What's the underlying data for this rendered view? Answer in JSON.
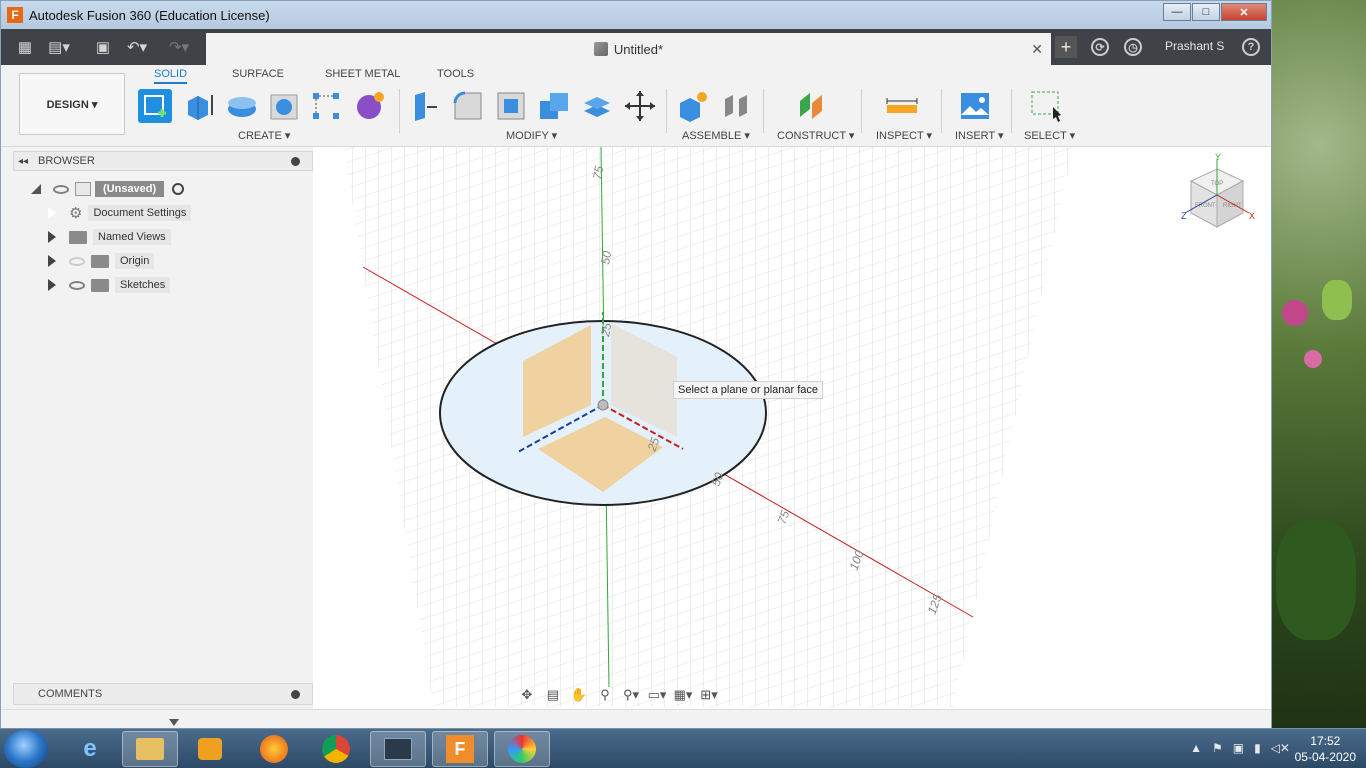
{
  "window": {
    "title": "Autodesk Fusion 360 (Education License)",
    "app_letter": "F"
  },
  "tabbar": {
    "doc_title": "Untitled*",
    "user": "Prashant S",
    "help": "?"
  },
  "toolbar": {
    "design_label": "DESIGN ▾",
    "workspace_tabs": [
      "SOLID",
      "SURFACE",
      "SHEET METAL",
      "TOOLS"
    ],
    "groups": [
      "CREATE ▾",
      "MODIFY ▾",
      "ASSEMBLE ▾",
      "CONSTRUCT ▾",
      "INSPECT ▾",
      "INSERT ▾",
      "SELECT ▾"
    ]
  },
  "browser": {
    "title": "BROWSER",
    "root": "(Unsaved)",
    "items": [
      "Document Settings",
      "Named Views",
      "Origin",
      "Sketches"
    ]
  },
  "comments": {
    "title": "COMMENTS"
  },
  "canvas": {
    "tooltip": "Select a plane or planar face",
    "axis_labels": {
      "y": [
        "75",
        "50",
        "25"
      ],
      "x": [
        "25",
        "50",
        "75",
        "100",
        "125"
      ]
    },
    "viewcube": {
      "top": "TOP",
      "front": "FRONT",
      "right": "RIGHT",
      "axis_x": "X",
      "axis_y": "Y",
      "axis_z": "Z"
    }
  },
  "taskbar": {
    "time": "17:52",
    "date": "05-04-2020"
  },
  "colors": {
    "accent": "#1f8fe0",
    "x_axis": "#c81e1e",
    "y_axis": "#2ea836",
    "z_axis": "#1e3ca0",
    "plane": "#f3c98a"
  }
}
